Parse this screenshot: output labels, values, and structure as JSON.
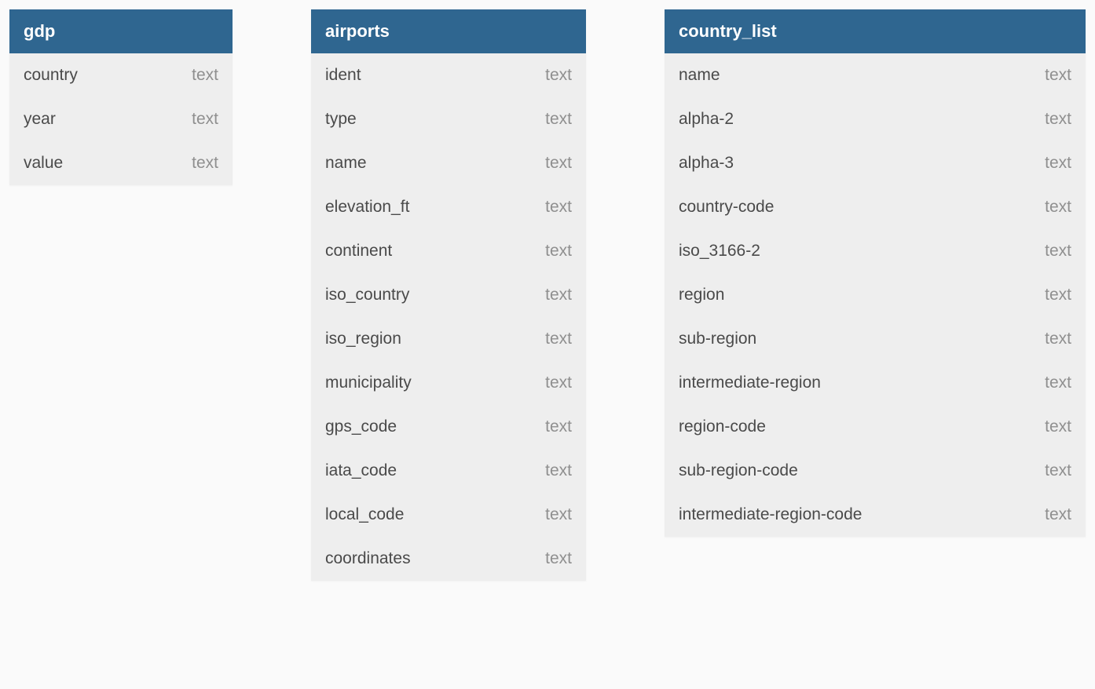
{
  "tables": [
    {
      "name": "gdp",
      "columns": [
        {
          "name": "country",
          "type": "text"
        },
        {
          "name": "year",
          "type": "text"
        },
        {
          "name": "value",
          "type": "text"
        }
      ]
    },
    {
      "name": "airports",
      "columns": [
        {
          "name": "ident",
          "type": "text"
        },
        {
          "name": "type",
          "type": "text"
        },
        {
          "name": "name",
          "type": "text"
        },
        {
          "name": "elevation_ft",
          "type": "text"
        },
        {
          "name": "continent",
          "type": "text"
        },
        {
          "name": "iso_country",
          "type": "text"
        },
        {
          "name": "iso_region",
          "type": "text"
        },
        {
          "name": "municipality",
          "type": "text"
        },
        {
          "name": "gps_code",
          "type": "text"
        },
        {
          "name": "iata_code",
          "type": "text"
        },
        {
          "name": "local_code",
          "type": "text"
        },
        {
          "name": "coordinates",
          "type": "text"
        }
      ]
    },
    {
      "name": "country_list",
      "columns": [
        {
          "name": "name",
          "type": "text"
        },
        {
          "name": "alpha-2",
          "type": "text"
        },
        {
          "name": "alpha-3",
          "type": "text"
        },
        {
          "name": "country-code",
          "type": "text"
        },
        {
          "name": "iso_3166-2",
          "type": "text"
        },
        {
          "name": "region",
          "type": "text"
        },
        {
          "name": "sub-region",
          "type": "text"
        },
        {
          "name": "intermediate-region",
          "type": "text"
        },
        {
          "name": "region-code",
          "type": "text"
        },
        {
          "name": "sub-region-code",
          "type": "text"
        },
        {
          "name": "intermediate-region-code",
          "type": "text"
        }
      ]
    }
  ]
}
